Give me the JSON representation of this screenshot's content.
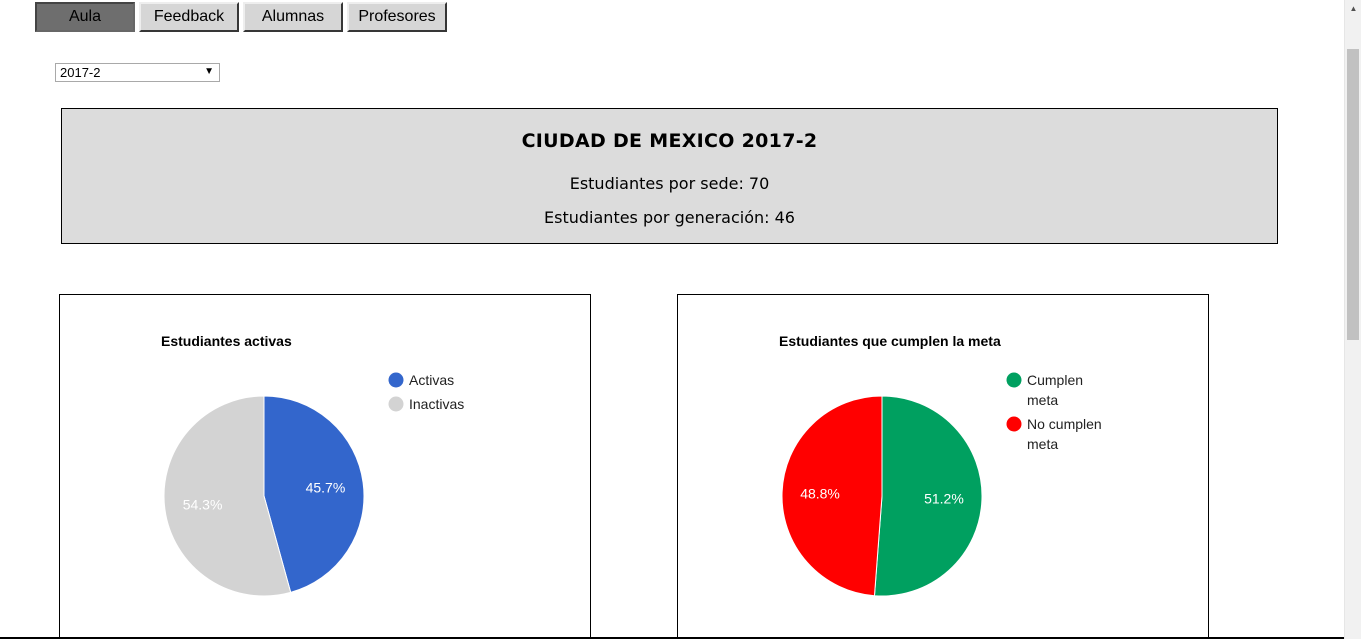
{
  "tabs": [
    {
      "label": "Aula",
      "active": true
    },
    {
      "label": "Feedback",
      "active": false
    },
    {
      "label": "Alumnas",
      "active": false
    },
    {
      "label": "Profesores",
      "active": false
    }
  ],
  "generation_select": {
    "value": "2017-2"
  },
  "summary": {
    "title": "CIUDAD DE MEXICO 2017-2",
    "students_by_campus": "Estudiantes por sede: 70",
    "students_by_generation": "Estudiantes por generación: 46"
  },
  "chart_data": [
    {
      "type": "pie",
      "title": "Estudiantes activas",
      "legend_position": "right",
      "slices": [
        {
          "label": "Activas",
          "value": 45.7,
          "display": "45.7%",
          "color": "#3366cc"
        },
        {
          "label": "Inactivas",
          "value": 54.3,
          "display": "54.3%",
          "color": "#d3d3d3"
        }
      ]
    },
    {
      "type": "pie",
      "title": "Estudiantes que cumplen la meta",
      "legend_position": "right",
      "slices": [
        {
          "label": "Cumplen meta",
          "legend_lines": [
            "Cumplen",
            "meta"
          ],
          "value": 51.2,
          "display": "51.2%",
          "color": "#00a060"
        },
        {
          "label": "No cumplen meta",
          "legend_lines": [
            "No cumplen",
            "meta"
          ],
          "value": 48.8,
          "display": "48.8%",
          "color": "#ff0000"
        }
      ]
    }
  ]
}
